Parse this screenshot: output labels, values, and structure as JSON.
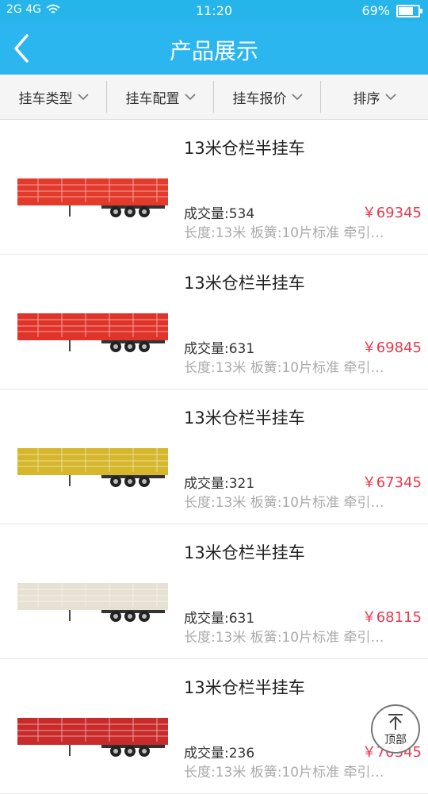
{
  "status": {
    "signal": "2G 4G",
    "time": "11:20",
    "battery": "69%",
    "battery_level": 0.69
  },
  "header": {
    "title": "产品展示"
  },
  "filters": [
    "挂车类型",
    "挂车配置",
    "挂车报价",
    "排序"
  ],
  "products": [
    {
      "name": "13米仓栏半挂车",
      "sales": "成交量:534",
      "price": "￥69345",
      "spec": "长度:13米 板簧:10片标准 牵引…",
      "color": "#e33a2b"
    },
    {
      "name": "13米仓栏半挂车",
      "sales": "成交量:631",
      "price": "￥69845",
      "spec": "长度:13米 板簧:10片标准 牵引…",
      "color": "#e0342a"
    },
    {
      "name": "13米仓栏半挂车",
      "sales": "成交量:321",
      "price": "￥67345",
      "spec": "长度:13米 板簧:10片标准 牵引…",
      "color": "#d6b62b"
    },
    {
      "name": "13米仓栏半挂车",
      "sales": "成交量:631",
      "price": "￥68115",
      "spec": "长度:13米 板簧:10片标准 牵引…",
      "color": "#e6e1d2"
    },
    {
      "name": "13米仓栏半挂车",
      "sales": "成交量:236",
      "price": "￥70345",
      "spec": "长度:13米 板簧:10片标准 牵引…",
      "color": "#c92b2b"
    }
  ],
  "top_button": {
    "label": "顶部"
  }
}
